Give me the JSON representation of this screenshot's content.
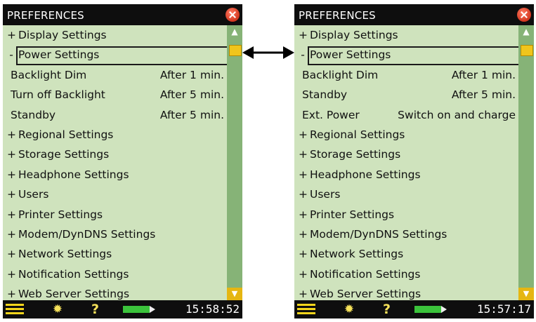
{
  "left": {
    "title": "PREFERENCES",
    "rows": [
      {
        "sign": "+",
        "label": "Display Settings"
      },
      {
        "sign": "-",
        "label": "Power Settings",
        "selected": true
      },
      {
        "sub": true,
        "label": "Backlight Dim",
        "value": "After 1 min."
      },
      {
        "sub": true,
        "label": "Turn off Backlight",
        "value": "After 5 min."
      },
      {
        "sub": true,
        "label": "Standby",
        "value": "After 5 min."
      },
      {
        "sign": "+",
        "label": "Regional Settings"
      },
      {
        "sign": "+",
        "label": "Storage Settings"
      },
      {
        "sign": "+",
        "label": "Headphone Settings"
      },
      {
        "sign": "+",
        "label": "Users"
      },
      {
        "sign": "+",
        "label": "Printer Settings"
      },
      {
        "sign": "+",
        "label": "Modem/DynDNS Settings"
      },
      {
        "sign": "+",
        "label": "Network Settings"
      },
      {
        "sign": "+",
        "label": "Notification Settings"
      },
      {
        "sign": "+",
        "label": "Web Server Settings"
      }
    ],
    "time": "15:58:52"
  },
  "right": {
    "title": "PREFERENCES",
    "rows": [
      {
        "sign": "+",
        "label": "Display Settings"
      },
      {
        "sign": "-",
        "label": "Power Settings",
        "selected": true
      },
      {
        "sub": true,
        "label": "Backlight Dim",
        "value": "After 1 min."
      },
      {
        "sub": true,
        "label": "Standby",
        "value": "After 5 min."
      },
      {
        "sub": true,
        "label": "Ext. Power",
        "value": "Switch on and charge"
      },
      {
        "sign": "+",
        "label": "Regional Settings"
      },
      {
        "sign": "+",
        "label": "Storage Settings"
      },
      {
        "sign": "+",
        "label": "Headphone Settings"
      },
      {
        "sign": "+",
        "label": "Users"
      },
      {
        "sign": "+",
        "label": "Printer Settings"
      },
      {
        "sign": "+",
        "label": "Modem/DynDNS Settings"
      },
      {
        "sign": "+",
        "label": "Network Settings"
      },
      {
        "sign": "+",
        "label": "Notification Settings"
      },
      {
        "sign": "+",
        "label": "Web Server Settings"
      }
    ],
    "time": "15:57:17"
  },
  "icons": {
    "close": "close-icon",
    "menu": "menu-icon",
    "backlight": "backlight-icon",
    "help": "help-icon",
    "battery": "battery-icon",
    "scroll_up": "chevron-up-icon",
    "scroll_down": "chevron-down-icon",
    "double_arrow": "double-arrow-icon"
  },
  "colors": {
    "background": "#cfe3bd",
    "bars": "#0e0e0e",
    "scrollbar": "#86b377",
    "scroll_accent": "#f0c51c",
    "battery": "#3bc33b",
    "close": "#d2371f"
  }
}
